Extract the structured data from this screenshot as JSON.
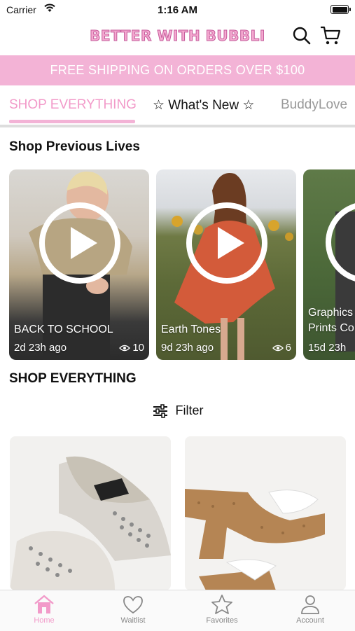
{
  "status_bar": {
    "carrier": "Carrier",
    "time": "1:16 AM"
  },
  "header": {
    "brand": "BETTER WITH BUBBLI",
    "search_icon": "search-icon",
    "cart_icon": "cart-icon"
  },
  "banner": {
    "text": "FREE SHIPPING ON ORDERS OVER $100"
  },
  "tabs": [
    "SHOP EVERYTHING",
    "☆ What's New ☆",
    "BuddyLove"
  ],
  "previous_lives": {
    "title": "Shop Previous Lives",
    "items": [
      {
        "name": "BACK TO SCHOOL",
        "ago": "2d 23h ago",
        "views": "10"
      },
      {
        "name": "Earth Tones",
        "ago": "9d 23h ago",
        "views": "6"
      },
      {
        "name": "Graphics",
        "name2": "Prints Co",
        "ago": "15d 23h"
      }
    ]
  },
  "shop_everything": {
    "title": "SHOP EVERYTHING",
    "filter_label": "Filter"
  },
  "tabbar": [
    {
      "label": "Home",
      "icon": "home-icon"
    },
    {
      "label": "Waitlist",
      "icon": "heart-icon"
    },
    {
      "label": "Favorites",
      "icon": "star-icon"
    },
    {
      "label": "Account",
      "icon": "person-icon"
    }
  ],
  "colors": {
    "accent_pink": "#f3b3d6",
    "active_pink": "#f29ac9"
  }
}
